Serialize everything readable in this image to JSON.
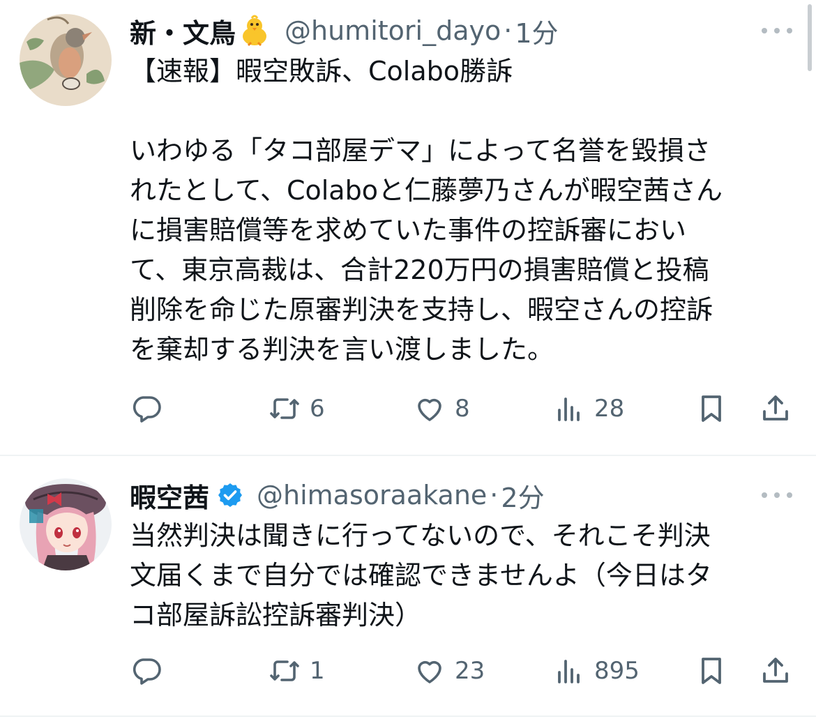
{
  "tweets": [
    {
      "display_name": "新・文鳥",
      "name_emoji": "baby-chick-emoji",
      "handle": "@humitori_dayo",
      "separator": "·",
      "time": "1分",
      "text": "【速報】暇空敗訴、Colabo勝訴\n\nいわゆる「タコ部屋デマ」によって名誉を毀損さ\nれたとして、Colaboと仁藤夢乃さんが暇空茜さん\nに損害賠償等を求めていた事件の控訴審におい\nて、東京高裁は、合計220万円の損害賠償と投稿\n削除を命じた原審判決を支持し、暇空さんの控訴\nを棄却する判決を言い渡しました。",
      "retweets": "6",
      "likes": "8",
      "views": "28"
    },
    {
      "display_name": "暇空茜",
      "verified": true,
      "handle": "@himasoraakane",
      "separator": "·",
      "time": "2分",
      "text": "当然判決は聞きに行ってないので、それこそ判決\n文届くまで自分では確認できませんよ（今日はタ\nコ部屋訴訟控訴審判決）",
      "retweets": "1",
      "likes": "23",
      "views": "895"
    }
  ],
  "icons": {
    "reply": "reply-icon",
    "retweet": "retweet-icon",
    "like": "heart-icon",
    "views": "views-icon",
    "bookmark": "bookmark-icon",
    "share": "share-icon",
    "more": "more-icon",
    "verified": "verified-badge-icon"
  },
  "colors": {
    "text": "#0f1419",
    "secondary": "#536471",
    "verified": "#1d9bf0",
    "divider": "#eff3f4"
  }
}
